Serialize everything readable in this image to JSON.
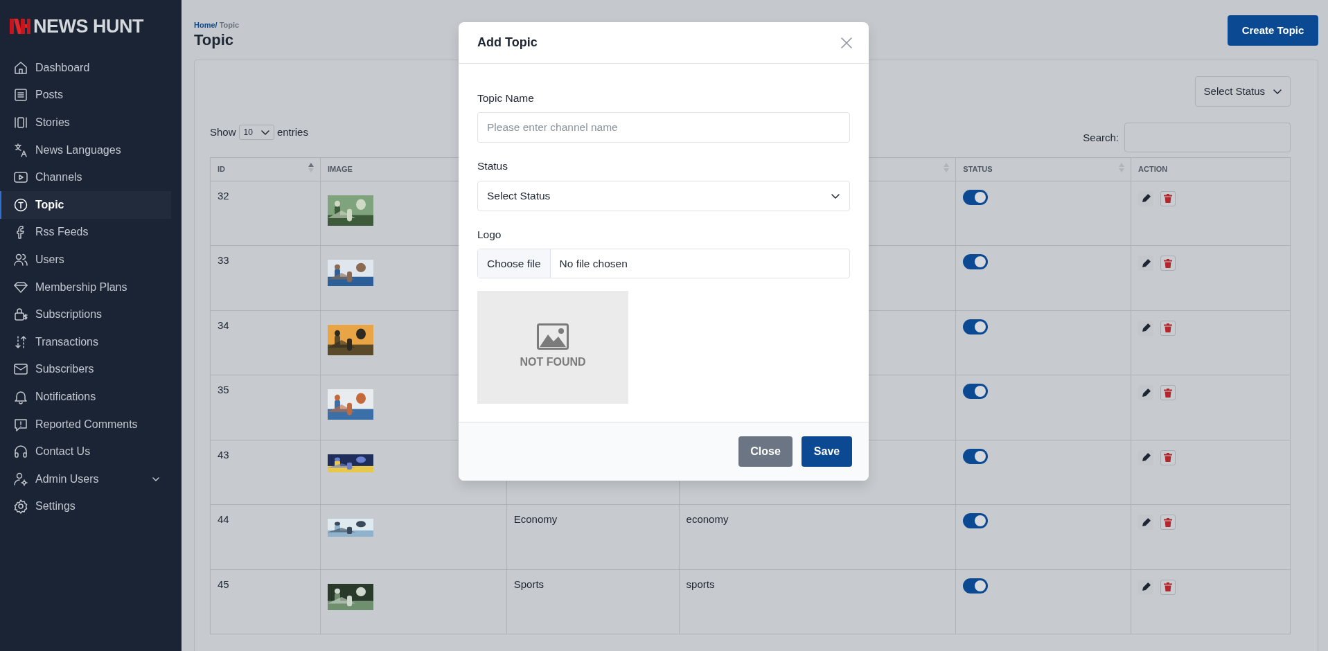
{
  "brand": {
    "name": "NEWS HUNT"
  },
  "sidebar": {
    "items": [
      {
        "label": "Dashboard",
        "selected": false,
        "kind": "link"
      },
      {
        "label": "Posts",
        "selected": false,
        "kind": "link"
      },
      {
        "label": "Stories",
        "selected": false,
        "kind": "link"
      },
      {
        "label": "News Languages",
        "selected": false,
        "kind": "link"
      },
      {
        "label": "Channels",
        "selected": false,
        "kind": "link"
      },
      {
        "label": "Topic",
        "selected": true,
        "kind": "link"
      },
      {
        "label": "Rss Feeds",
        "selected": false,
        "kind": "link"
      },
      {
        "label": "Users",
        "selected": false,
        "kind": "link"
      },
      {
        "label": "Membership Plans",
        "selected": false,
        "kind": "link"
      },
      {
        "label": "Subscriptions",
        "selected": false,
        "kind": "link"
      },
      {
        "label": "Transactions",
        "selected": false,
        "kind": "link"
      },
      {
        "label": "Subscribers",
        "selected": false,
        "kind": "link"
      },
      {
        "label": "Notifications",
        "selected": false,
        "kind": "link"
      },
      {
        "label": "Reported Comments",
        "selected": false,
        "kind": "link"
      },
      {
        "label": "Contact Us",
        "selected": false,
        "kind": "link"
      },
      {
        "label": "Admin Users",
        "selected": false,
        "kind": "group",
        "expanded": false
      },
      {
        "label": "Settings",
        "selected": false,
        "kind": "link"
      }
    ]
  },
  "breadcrumb": [
    {
      "label": "Home/",
      "kind": "link"
    },
    {
      "label": "Topic",
      "kind": "current"
    }
  ],
  "page_title": "Topic",
  "create_button": "Create Topic",
  "status_filter": "Select Status",
  "length": {
    "before": "Show",
    "value": "10",
    "after": "entries"
  },
  "search": {
    "label": "Search:"
  },
  "table": {
    "columns": [
      {
        "label": "ID",
        "sortable": true,
        "sorted": true
      },
      {
        "label": "IMAGE"
      },
      {},
      {
        "sortable": true,
        "sorted": false
      },
      {
        "label": "STATUS",
        "sortable": true,
        "sorted": false
      },
      {
        "label": "ACTION",
        "sortable": false
      }
    ],
    "rows": [
      {
        "id": "32",
        "on": true
      },
      {
        "id": "33",
        "on": true
      },
      {
        "id": "34",
        "on": true
      },
      {
        "id": "35",
        "on": true
      },
      {
        "id": "43",
        "on": true
      },
      {
        "id": "44",
        "name": "Economy",
        "slug": "economy",
        "on": true
      },
      {
        "id": "45",
        "name": "Sports",
        "slug": "sports",
        "on": true
      }
    ]
  },
  "modal": {
    "title": "Add Topic",
    "fields": [
      {
        "label": "Topic Name",
        "kind": "text",
        "placeholder": "Please enter channel name"
      },
      {
        "label": "Status",
        "kind": "select",
        "value": "Select Status"
      },
      {
        "label": "Logo",
        "kind": "file",
        "button": "Choose file",
        "value": "No file chosen"
      }
    ],
    "preview": "NOT FOUND",
    "buttons": [
      {
        "label": "Close",
        "kind": "secondary"
      },
      {
        "label": "Save",
        "kind": "primary"
      }
    ]
  }
}
